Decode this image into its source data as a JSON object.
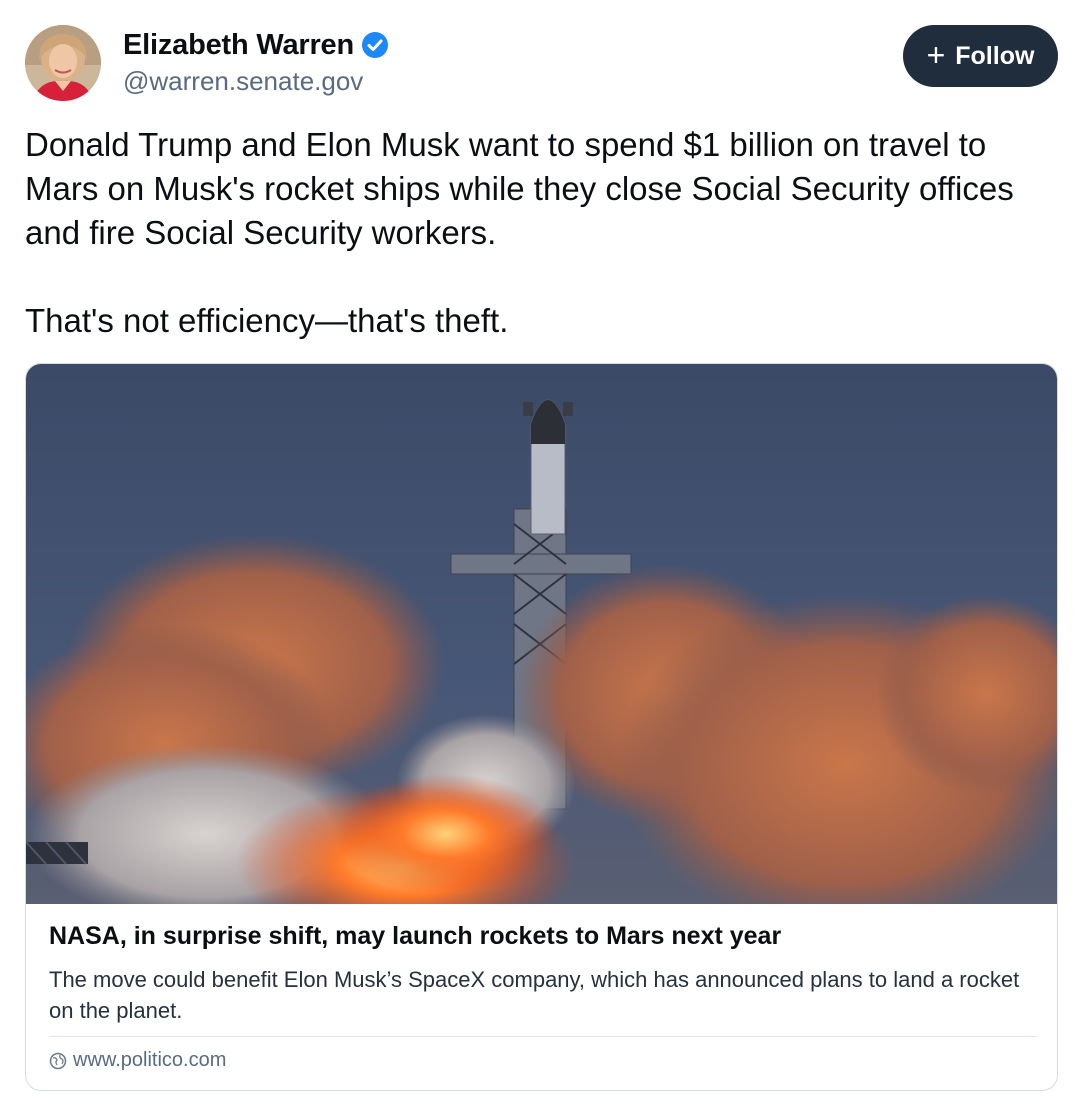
{
  "author": {
    "name": "Elizabeth Warren",
    "handle": "@warren.senate.gov",
    "verified": true
  },
  "follow_button": {
    "icon": "plus-icon",
    "label": "Follow"
  },
  "post": {
    "paragraphs": [
      "Donald Trump and Elon Musk want to spend $1 billion on travel to Mars on Musk's rocket ships while they close Social Security offices and fire Social Security workers.",
      "That's not efficiency—that's theft."
    ]
  },
  "link_card": {
    "title": "NASA, in surprise shift, may launch rockets to Mars next year",
    "description": "The move could benefit Elon Musk’s SpaceX company, which has announced plans to land a rocket on the planet.",
    "domain": "www.politico.com",
    "domain_icon": "globe-icon"
  },
  "colors": {
    "follow_bg": "#1f2d3d",
    "verified": "#1e88f7",
    "handle": "#5a6b80"
  }
}
